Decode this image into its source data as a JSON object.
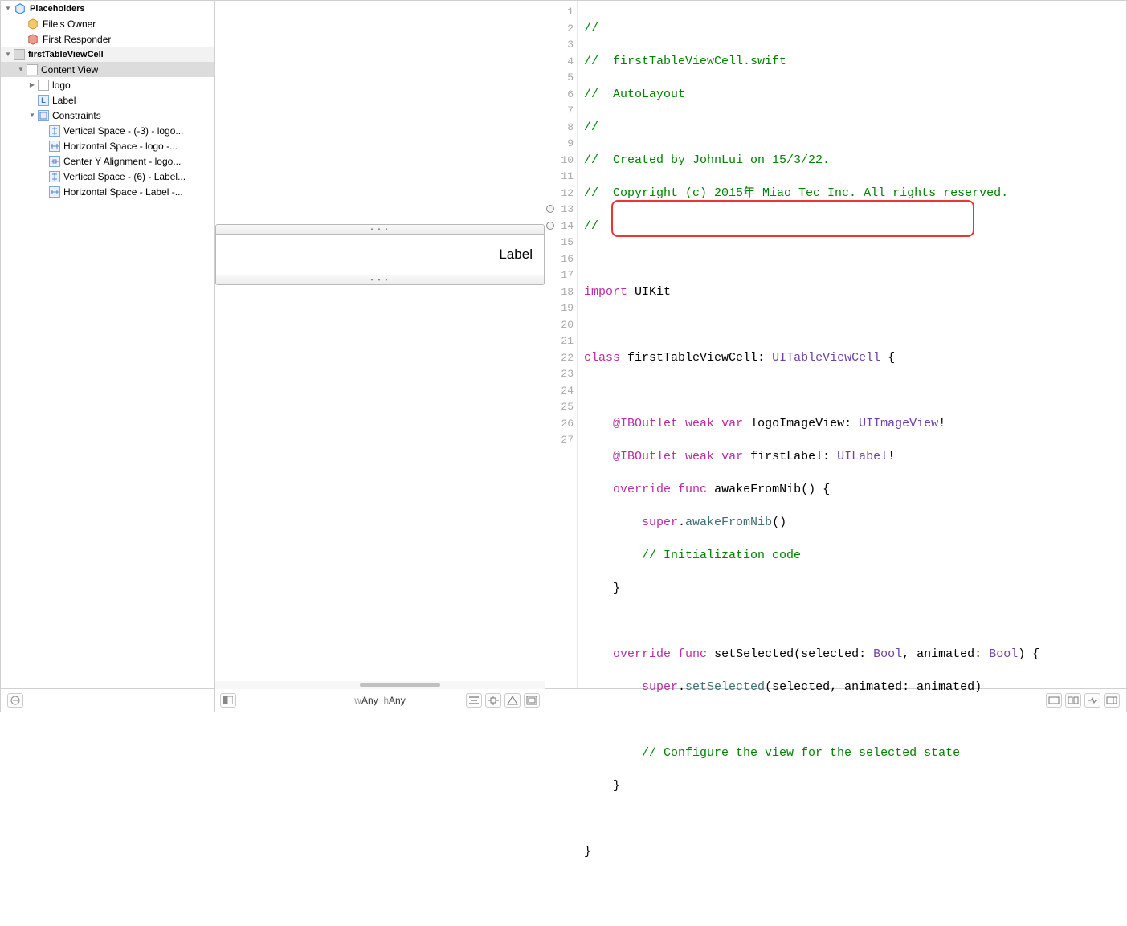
{
  "outline": {
    "placeholders_label": "Placeholders",
    "files_owner": "File's Owner",
    "first_responder": "First Responder",
    "cell_name": "firstTableViewCell",
    "content_view": "Content View",
    "logo": "logo",
    "label": "Label",
    "constraints_label": "Constraints",
    "constraints": [
      "Vertical Space - (-3) - logo...",
      "Horizontal Space - logo -...",
      "Center Y Alignment - logo...",
      "Vertical Space - (6) - Label...",
      "Horizontal Space - Label -..."
    ]
  },
  "canvas": {
    "label_text": "Label"
  },
  "editor": {
    "line_count": 27,
    "code": {
      "l1": "//",
      "l2_pre": "//  ",
      "l2_txt": "firstTableViewCell.swift",
      "l3_pre": "//  ",
      "l3_txt": "AutoLayout",
      "l4": "//",
      "l5_pre": "//  ",
      "l5_txt": "Created by JohnLui on 15/3/22.",
      "l6_pre": "//  ",
      "l6_txt": "Copyright (c) 2015年 Miao Tec Inc. All rights reserved.",
      "l7": "//",
      "l9_import": "import",
      "l9_mod": "UIKit",
      "l11_class": "class",
      "l11_name": "firstTableViewCell",
      "l11_colon": ": ",
      "l11_super": "UITableViewCell",
      "l11_brace": " {",
      "l13_attr": "@IBOutlet",
      "l13_weak": "weak",
      "l13_var": "var",
      "l13_name": "logoImageView",
      "l13_type": "UIImageView",
      "l13_bang": "!",
      "l14_attr": "@IBOutlet",
      "l14_weak": "weak",
      "l14_var": "var",
      "l14_name": "firstLabel",
      "l14_type": "UILabel",
      "l14_bang": "!",
      "l15_override": "override",
      "l15_func": "func",
      "l15_name": "awakeFromNib",
      "l15_paren": "() {",
      "l16_super": "super",
      "l16_dot": ".",
      "l16_call": "awakeFromNib",
      "l16_paren": "()",
      "l17_comment": "// Initialization code",
      "l18_brace": "}",
      "l20_override": "override",
      "l20_func": "func",
      "l20_name": "setSelected",
      "l20_open": "(selected: ",
      "l20_bool1": "Bool",
      "l20_mid": ", animated: ",
      "l20_bool2": "Bool",
      "l20_close": ") {",
      "l21_super": "super",
      "l21_dot": ".",
      "l21_call": "setSelected",
      "l21_args": "(selected, animated: animated)",
      "l23_comment": "// Configure the view for the selected state",
      "l24_brace": "}",
      "l26_brace": "}"
    }
  },
  "bottom": {
    "size_w_prefix": "w",
    "size_w": "Any",
    "size_h_prefix": "h",
    "size_h": "Any"
  }
}
